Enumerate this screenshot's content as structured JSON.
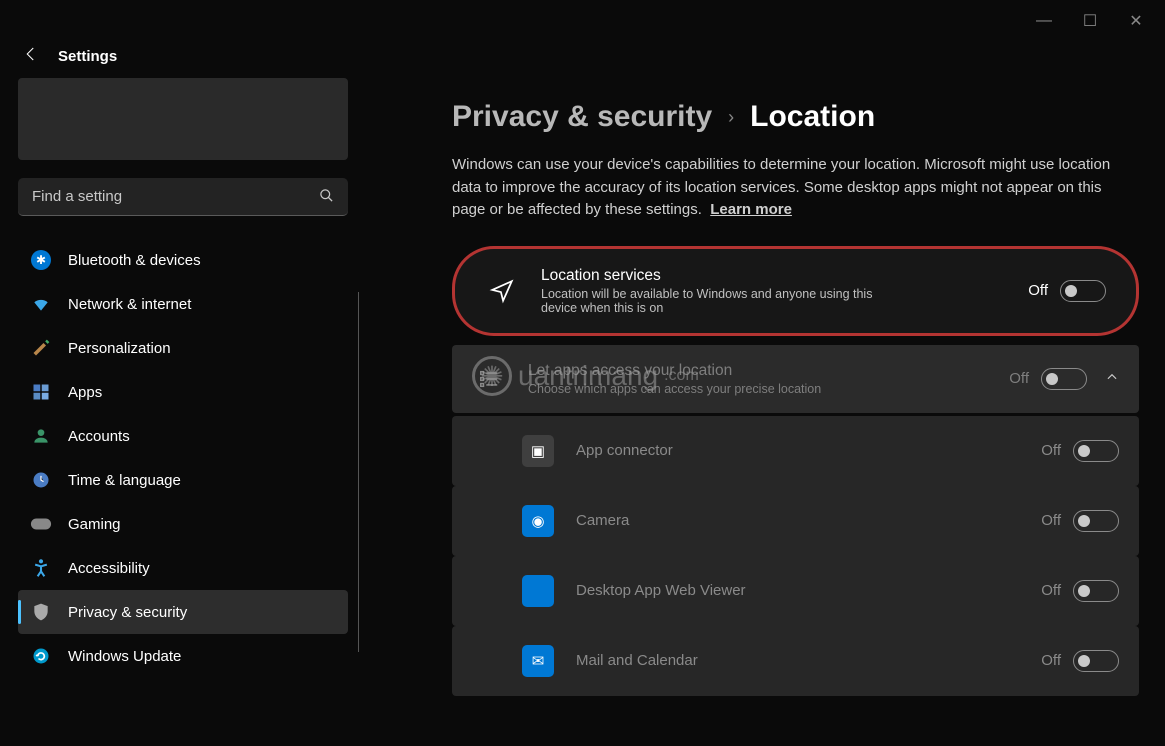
{
  "app_title": "Settings",
  "search_placeholder": "Find a setting",
  "window_controls": {
    "minimize": "—",
    "maximize": "☐",
    "close": "✕"
  },
  "nav": [
    {
      "icon": "bt",
      "label": "Bluetooth & devices",
      "active": false
    },
    {
      "icon": "wifi",
      "label": "Network & internet",
      "active": false
    },
    {
      "icon": "pers",
      "label": "Personalization",
      "active": false
    },
    {
      "icon": "apps",
      "label": "Apps",
      "active": false
    },
    {
      "icon": "acct",
      "label": "Accounts",
      "active": false
    },
    {
      "icon": "time",
      "label": "Time & language",
      "active": false
    },
    {
      "icon": "game",
      "label": "Gaming",
      "active": false
    },
    {
      "icon": "acc",
      "label": "Accessibility",
      "active": false
    },
    {
      "icon": "priv",
      "label": "Privacy & security",
      "active": true
    },
    {
      "icon": "upd",
      "label": "Windows Update",
      "active": false
    }
  ],
  "breadcrumb": {
    "parent": "Privacy & security",
    "current": "Location"
  },
  "description": "Windows can use your device's capabilities to determine your location. Microsoft might use location data to improve the accuracy of its location services. Some desktop apps might not appear on this page or be affected by these settings.",
  "learn_more": "Learn more",
  "location_services": {
    "title": "Location services",
    "subtitle": "Location will be available to Windows and anyone using this device when this is on",
    "state": "Off"
  },
  "app_access": {
    "title": "Let apps access your location",
    "subtitle": "Choose which apps can access your precise location",
    "state": "Off"
  },
  "apps": [
    {
      "name": "App connector",
      "state": "Off",
      "color": "#3f3f3f",
      "glyph": "▣"
    },
    {
      "name": "Camera",
      "state": "Off",
      "color": "#0078d4",
      "glyph": "◉"
    },
    {
      "name": "Desktop App Web Viewer",
      "state": "Off",
      "color": "#0078d4",
      "glyph": ""
    },
    {
      "name": "Mail and Calendar",
      "state": "Off",
      "color": "#0078d4",
      "glyph": "✉"
    }
  ],
  "watermark": "uantrimang"
}
